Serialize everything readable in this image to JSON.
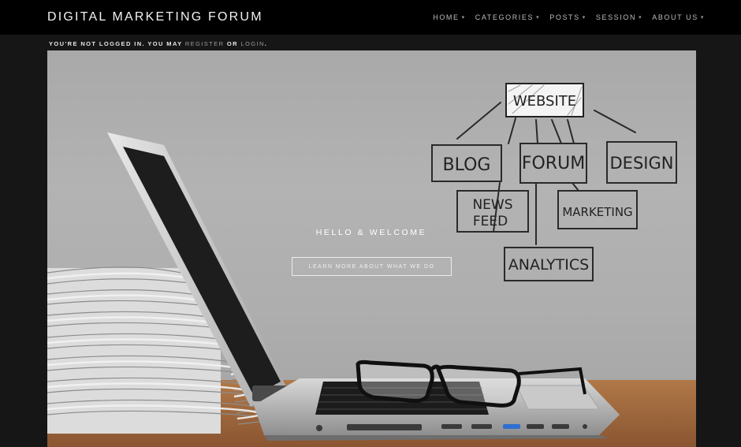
{
  "header": {
    "brand": "DIGITAL MARKETING FORUM",
    "nav": [
      {
        "label": "HOME"
      },
      {
        "label": "CATEGORIES"
      },
      {
        "label": "POSTS"
      },
      {
        "label": "SESSION"
      },
      {
        "label": "ABOUT US"
      }
    ]
  },
  "login_notice": {
    "prefix": "YOU'RE NOT LOGGED IN. YOU MAY",
    "register": "REGISTER",
    "or": "OR",
    "login": "LOGIN",
    "suffix": "."
  },
  "hero": {
    "title": "HELLO & WELCOME",
    "cta": "LEARN MORE ABOUT WHAT WE DO",
    "sketch": {
      "website": "WEBSITE",
      "blog": "BLOG",
      "forum": "FORUM",
      "design": "DESIGN",
      "news_1": "NEWS",
      "news_2": "FEED",
      "marketing": "MARKETING",
      "analytics": "ANALYTICS"
    }
  },
  "colors": {
    "topbar": "#000000",
    "page_bg": "#161616",
    "hero_bg": "#aeaeae"
  }
}
